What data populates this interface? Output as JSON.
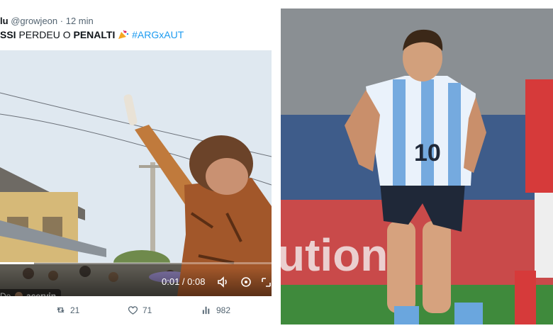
{
  "tweet": {
    "name": "lu",
    "handle": "@growjeon",
    "separator": "·",
    "time": "12 min",
    "text": {
      "part1": "SSI",
      "part2": " PERDEU O ",
      "part3": "PENALTI",
      "hashtag": "#ARGxAUT"
    },
    "video": {
      "attribution_prefix": "De",
      "attribution_handle": "acervin",
      "time_display": "0:01 / 0:08",
      "progress": 0.125
    },
    "actions": {
      "retweets": "21",
      "likes": "71",
      "views": "982"
    }
  },
  "colors": {
    "link": "#1d9bf0",
    "muted": "#536471",
    "text": "#0f1419"
  },
  "icons": [
    "party-popper-icon",
    "volume-icon",
    "settings-icon",
    "fullscreen-icon",
    "retweet-icon",
    "heart-icon",
    "views-icon"
  ]
}
